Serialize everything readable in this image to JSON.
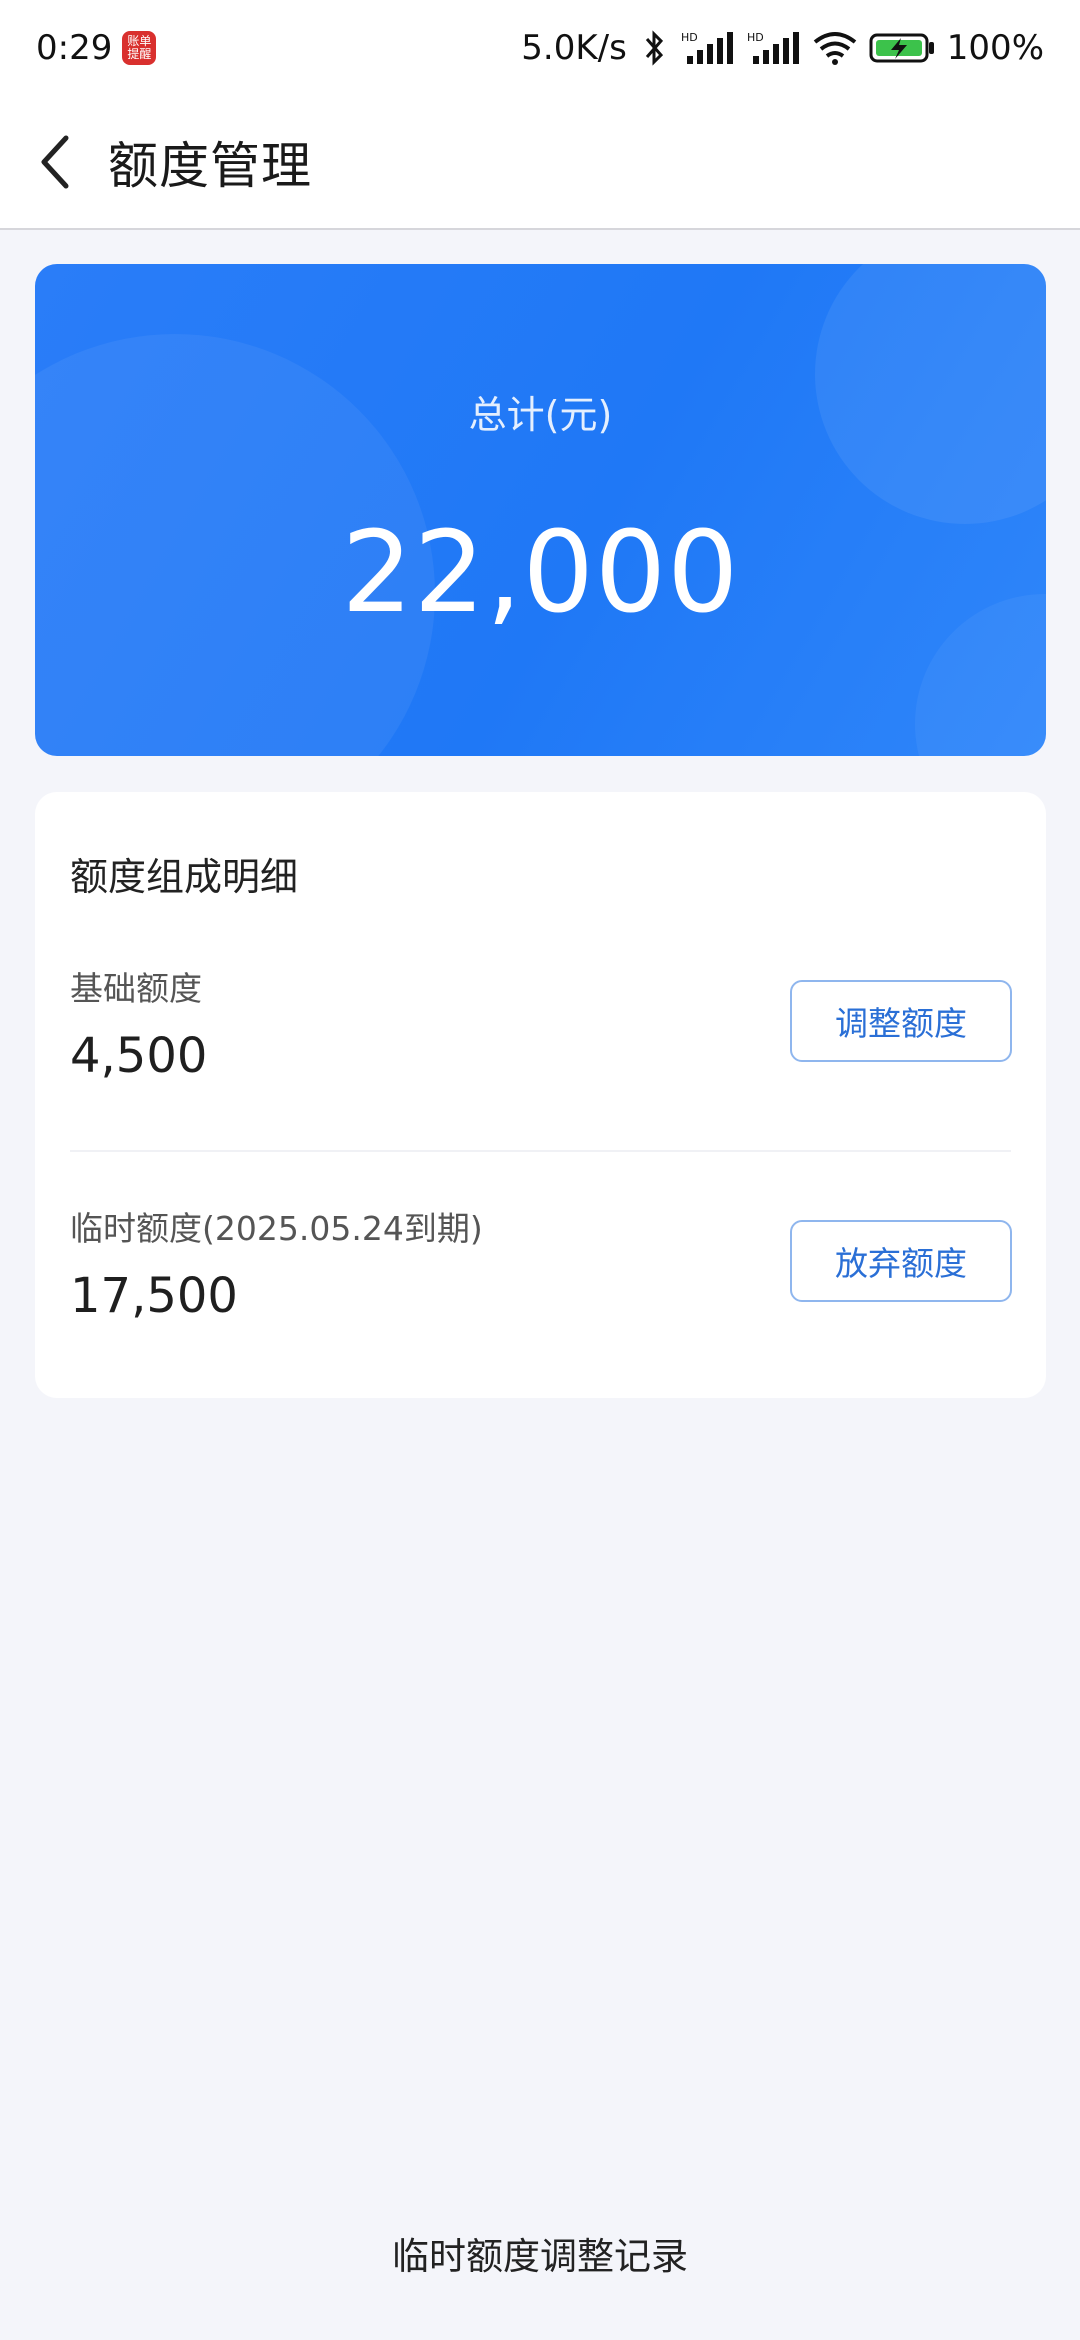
{
  "status_bar": {
    "time": "0:29",
    "app_notification": "账单\n提醒",
    "net_speed": "5.0K/s",
    "battery": "100%",
    "icons": [
      "bluetooth-icon",
      "hd-signal-icon",
      "hd-signal-icon",
      "wifi-icon",
      "battery-charging-icon"
    ]
  },
  "header": {
    "back_icon": "chevron-left-icon",
    "title": "额度管理"
  },
  "total_card": {
    "label": "总计(元)",
    "value": "22,000",
    "color": "#2a7df8"
  },
  "detail": {
    "title": "额度组成明细",
    "items": [
      {
        "label": "基础额度",
        "value": "4,500",
        "button": "调整额度"
      },
      {
        "label": "临时额度(2025.05.24到期)",
        "value": "17,500",
        "button": "放弃额度"
      }
    ]
  },
  "footer": {
    "link": "临时额度调整记录"
  }
}
